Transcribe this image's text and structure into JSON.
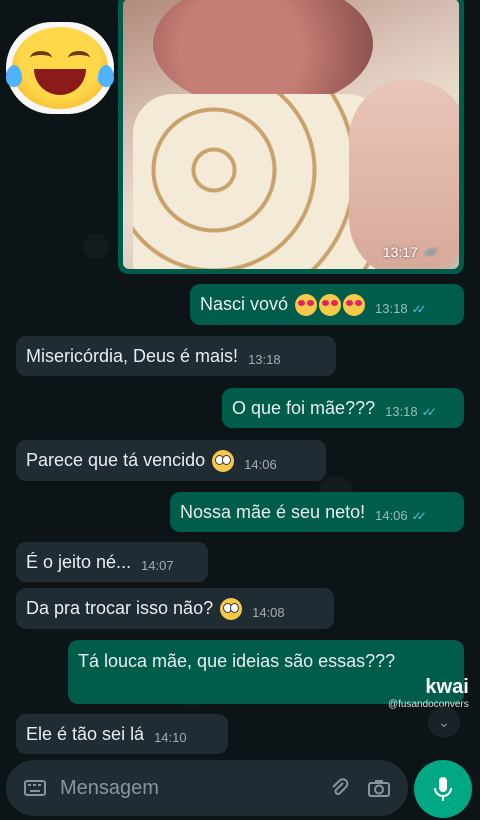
{
  "messages": [
    {
      "dir": "out",
      "text": "Nasci vovó",
      "emoji": "love",
      "emoji_count": 3,
      "time": "13:18",
      "ticks": "read"
    },
    {
      "dir": "in",
      "text": "Misericórdia, Deus é mais!",
      "time": "13:18"
    },
    {
      "dir": "out",
      "text": "O que foi mãe???",
      "time": "13:18",
      "ticks": "read"
    },
    {
      "dir": "in",
      "text": "Parece que tá vencido",
      "emoji": "flushed",
      "time": "14:06"
    },
    {
      "dir": "out",
      "text": "Nossa mãe é seu neto!",
      "time": "14:06",
      "ticks": "read"
    },
    {
      "dir": "in",
      "text": "É o jeito né...",
      "time": "14:07"
    },
    {
      "dir": "in",
      "text": "Da pra trocar isso não?",
      "emoji": "eyeroll",
      "time": "14:08"
    },
    {
      "dir": "out",
      "text": "Tá louca mãe, que ideias são essas???",
      "time": ""
    },
    {
      "dir": "in",
      "text": "Ele é tão sei lá",
      "time": "14:10"
    }
  ],
  "media": {
    "time": "13:17",
    "ticks": "read",
    "icon": "baby-photo"
  },
  "sticker": {
    "icon": "tears-of-joy-emoji"
  },
  "watermark": {
    "brand": "kwai",
    "handle": "@fusandoconvers"
  },
  "composer": {
    "placeholder": "Mensagem",
    "icons": [
      "keyboard-icon",
      "attach-icon",
      "camera-icon",
      "mic-icon"
    ]
  },
  "colors": {
    "outgoing": "#005c4b",
    "incoming": "#202c33",
    "accent": "#00a884",
    "read_ticks": "#53bdeb"
  }
}
